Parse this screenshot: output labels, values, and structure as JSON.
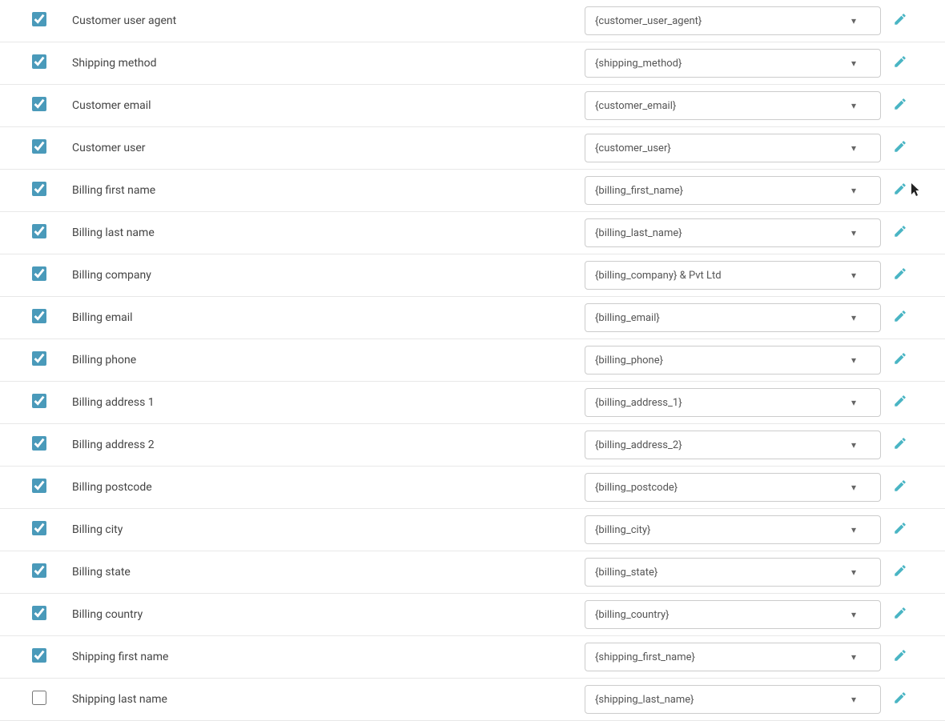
{
  "rows": [
    {
      "id": "customer-user-agent",
      "label": "Customer user agent",
      "value": "{customer_user_agent}",
      "checked": true,
      "hasCursor": false
    },
    {
      "id": "shipping-method",
      "label": "Shipping method",
      "value": "{shipping_method}",
      "checked": true,
      "hasCursor": false
    },
    {
      "id": "customer-email",
      "label": "Customer email",
      "value": "{customer_email}",
      "checked": true,
      "hasCursor": false
    },
    {
      "id": "customer-user",
      "label": "Customer user",
      "value": "{customer_user}",
      "checked": true,
      "hasCursor": false
    },
    {
      "id": "billing-first-name",
      "label": "Billing first name",
      "value": "{billing_first_name}",
      "checked": true,
      "hasCursor": true
    },
    {
      "id": "billing-last-name",
      "label": "Billing last name",
      "value": "{billing_last_name}",
      "checked": true,
      "hasCursor": false
    },
    {
      "id": "billing-company",
      "label": "Billing company",
      "value": "{billing_company} & Pvt Ltd",
      "checked": true,
      "hasCursor": false
    },
    {
      "id": "billing-email",
      "label": "Billing email",
      "value": "{billing_email}",
      "checked": true,
      "hasCursor": false
    },
    {
      "id": "billing-phone",
      "label": "Billing phone",
      "value": "{billing_phone}",
      "checked": true,
      "hasCursor": false
    },
    {
      "id": "billing-address-1",
      "label": "Billing address 1",
      "value": "{billing_address_1}",
      "checked": true,
      "hasCursor": false
    },
    {
      "id": "billing-address-2",
      "label": "Billing address 2",
      "value": "{billing_address_2}",
      "checked": true,
      "hasCursor": false
    },
    {
      "id": "billing-postcode",
      "label": "Billing postcode",
      "value": "{billing_postcode}",
      "checked": true,
      "hasCursor": false
    },
    {
      "id": "billing-city",
      "label": "Billing city",
      "value": "{billing_city}",
      "checked": true,
      "hasCursor": false
    },
    {
      "id": "billing-state",
      "label": "Billing state",
      "value": "{billing_state}",
      "checked": true,
      "hasCursor": false
    },
    {
      "id": "billing-country",
      "label": "Billing country",
      "value": "{billing_country}",
      "checked": true,
      "hasCursor": false
    },
    {
      "id": "shipping-first-name",
      "label": "Shipping first name",
      "value": "{shipping_first_name}",
      "checked": true,
      "hasCursor": false
    },
    {
      "id": "shipping-last-name",
      "label": "Shipping last name",
      "value": "{shipping_last_name}",
      "checked": false,
      "hasCursor": false
    }
  ],
  "icons": {
    "chevron": "▾",
    "edit": "✎"
  }
}
